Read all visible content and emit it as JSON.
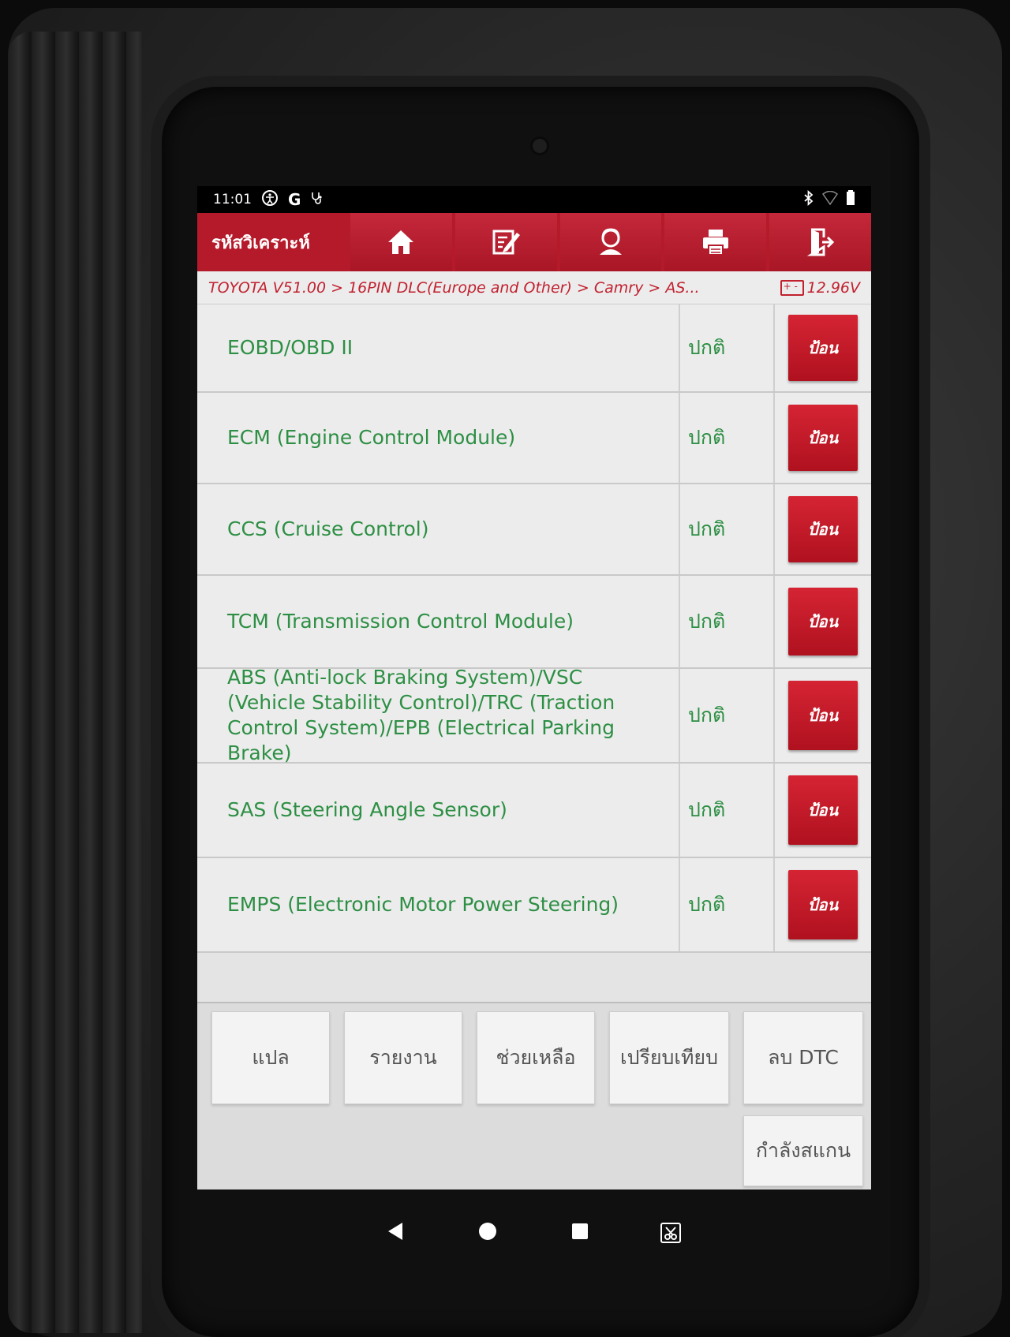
{
  "status_bar": {
    "time": "11:01",
    "icons": [
      "accessibility-icon",
      "google-icon",
      "stethoscope-icon",
      "bluetooth-icon",
      "wifi-icon",
      "battery-icon"
    ],
    "google_letter": "G"
  },
  "toolbar": {
    "title": "รหัสวิเคราะห์",
    "buttons": [
      "home-icon",
      "edit-report-icon",
      "user-support-icon",
      "print-icon",
      "exit-icon"
    ],
    "accent_color": "#b51a2b"
  },
  "breadcrumb": {
    "path": "TOYOTA V51.00 > 16PIN DLC(Europe and Other) > Camry > AS...",
    "voltage": "12.96V"
  },
  "modules": [
    {
      "name": "EOBD/OBD II",
      "status": "ปกติ",
      "action": "ป้อน"
    },
    {
      "name": "ECM (Engine Control Module)",
      "status": "ปกติ",
      "action": "ป้อน"
    },
    {
      "name": "CCS (Cruise Control)",
      "status": "ปกติ",
      "action": "ป้อน"
    },
    {
      "name": "TCM (Transmission Control Module)",
      "status": "ปกติ",
      "action": "ป้อน"
    },
    {
      "name": "ABS (Anti-lock Braking System)/VSC (Vehicle Stability Control)/TRC (Traction Control System)/EPB (Electrical Parking Brake)",
      "status": "ปกติ",
      "action": "ป้อน"
    },
    {
      "name": "SAS (Steering Angle Sensor)",
      "status": "ปกติ",
      "action": "ป้อน"
    },
    {
      "name": "EMPS (Electronic Motor Power Steering)",
      "status": "ปกติ",
      "action": "ป้อน"
    }
  ],
  "bottom_buttons": {
    "translate": "แปล",
    "report": "รายงาน",
    "help": "ช่วยเหลือ",
    "compare": "เปรียบเทียบ",
    "clear_dtc": "ลบ DTC",
    "scanning": "กำลังสแกน"
  },
  "nav_bar": [
    "back-icon",
    "home-circle-icon",
    "recents-icon",
    "screenshot-icon"
  ]
}
